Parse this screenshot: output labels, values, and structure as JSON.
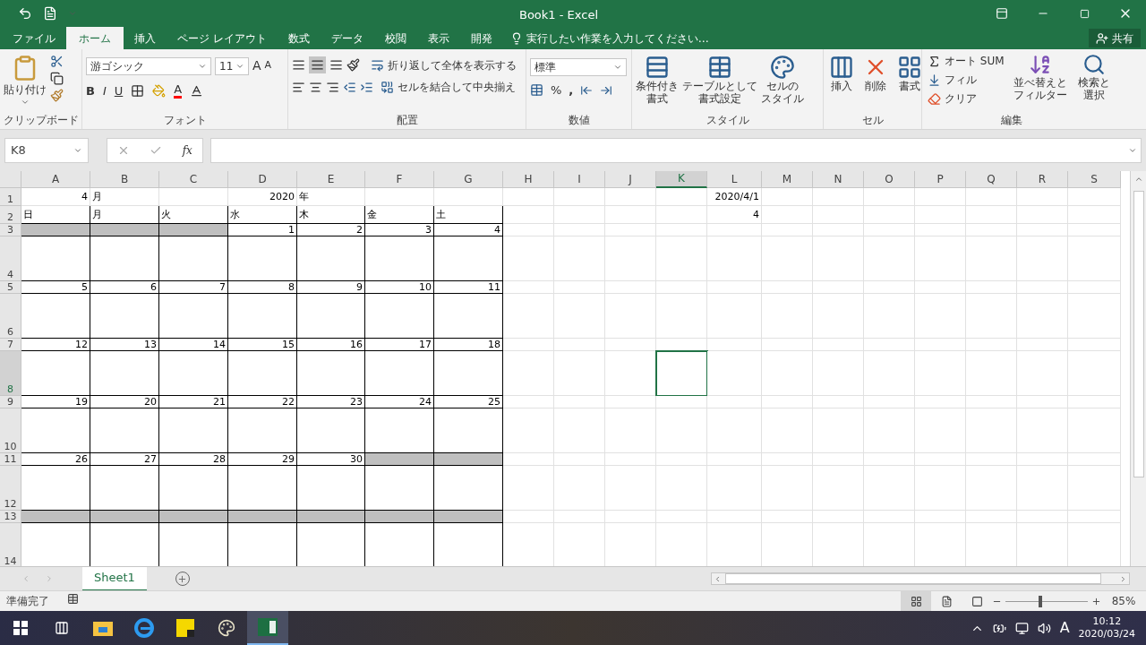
{
  "title_bar": {
    "title": "Book1 - Excel"
  },
  "tabs": [
    {
      "label": "ファイル",
      "selected": false
    },
    {
      "label": "ホーム",
      "selected": true
    },
    {
      "label": "挿入",
      "selected": false
    },
    {
      "label": "ページ レイアウト",
      "selected": false
    },
    {
      "label": "数式",
      "selected": false
    },
    {
      "label": "データ",
      "selected": false
    },
    {
      "label": "校閲",
      "selected": false
    },
    {
      "label": "表示",
      "selected": false
    },
    {
      "label": "開発",
      "selected": false
    }
  ],
  "tell_me": {
    "placeholder": "実行したい作業を入力してください…"
  },
  "share": "共有",
  "ribbon": {
    "clipboard": {
      "label": "クリップボード",
      "paste": "貼り付け"
    },
    "font": {
      "label": "フォント",
      "font_name": "游ゴシック",
      "font_size": "11",
      "grow": "A",
      "shrink": "A",
      "bold": "B",
      "italic": "I",
      "underline": "U",
      "font_color": "A"
    },
    "alignment": {
      "label": "配置",
      "wrap": "折り返して全体を表示する",
      "merge": "セルを結合して中央揃え"
    },
    "number": {
      "label": "数値",
      "format": "標準",
      "percent": "%",
      "comma": ","
    },
    "styles": {
      "label": "スタイル",
      "buttons": [
        [
          "条件付き",
          "書式"
        ],
        [
          "テーブルとして",
          "書式設定"
        ],
        [
          "セルの",
          "スタイル"
        ]
      ]
    },
    "cells": {
      "label": "セル",
      "buttons": [
        "挿入",
        "削除",
        "書式"
      ]
    },
    "editing": {
      "label": "編集",
      "autosum": "オート SUM",
      "fill": "フィル",
      "clear": "クリア",
      "sort": [
        "並べ替えと",
        "フィルター"
      ],
      "find": [
        "検索と",
        "選択"
      ]
    }
  },
  "formula_bar": {
    "name_box": "K8",
    "fx": "fx"
  },
  "grid": {
    "columns": [
      {
        "label": "A",
        "selected": false
      },
      {
        "label": "B",
        "selected": false
      },
      {
        "label": "C",
        "selected": false
      },
      {
        "label": "D",
        "selected": false
      },
      {
        "label": "E",
        "selected": false
      },
      {
        "label": "F",
        "selected": false
      },
      {
        "label": "G",
        "selected": false
      },
      {
        "label": "H",
        "selected": false
      },
      {
        "label": "I",
        "selected": false
      },
      {
        "label": "J",
        "selected": false
      },
      {
        "label": "K",
        "selected": true
      },
      {
        "label": "L",
        "selected": false
      },
      {
        "label": "M",
        "selected": false
      },
      {
        "label": "N",
        "selected": false
      },
      {
        "label": "O",
        "selected": false
      },
      {
        "label": "P",
        "selected": false
      },
      {
        "label": "Q",
        "selected": false
      },
      {
        "label": "R",
        "selected": false
      },
      {
        "label": "S",
        "selected": false
      }
    ],
    "rows": [
      {
        "label": "1",
        "selected": false,
        "kind": "title",
        "cells": [
          {
            "text": "4",
            "kind": "number"
          },
          {
            "text": "月",
            "kind": "text"
          },
          null,
          {
            "text": "2020",
            "kind": "number"
          },
          {
            "text": "年",
            "kind": "text"
          },
          null,
          null
        ],
        "column_l": "2020/4/1"
      },
      {
        "label": "2",
        "selected": false,
        "kind": "weekday",
        "cells": [
          {
            "text": "日",
            "kind": "text"
          },
          {
            "text": "月",
            "kind": "text"
          },
          {
            "text": "火",
            "kind": "text"
          },
          {
            "text": "水",
            "kind": "text"
          },
          {
            "text": "木",
            "kind": "text"
          },
          {
            "text": "金",
            "kind": "text"
          },
          {
            "text": "土",
            "kind": "text"
          }
        ],
        "column_l": "4"
      },
      {
        "label": "3",
        "selected": false,
        "kind": "dates",
        "cells": [
          {
            "shaded": true
          },
          {
            "shaded": true
          },
          {
            "shaded": true
          },
          {
            "text": "1",
            "shaded": false
          },
          {
            "text": "2",
            "shaded": false
          },
          {
            "text": "3",
            "shaded": false
          },
          {
            "text": "4",
            "shaded": false
          }
        ]
      },
      {
        "label": "4",
        "selected": false,
        "kind": "notes"
      },
      {
        "label": "5",
        "selected": false,
        "kind": "dates",
        "cells": [
          {
            "text": "5",
            "shaded": false
          },
          {
            "text": "6",
            "shaded": false
          },
          {
            "text": "7",
            "shaded": false
          },
          {
            "text": "8",
            "shaded": false
          },
          {
            "text": "9",
            "shaded": false
          },
          {
            "text": "10",
            "shaded": false
          },
          {
            "text": "11",
            "shaded": false
          }
        ]
      },
      {
        "label": "6",
        "selected": false,
        "kind": "notes"
      },
      {
        "label": "7",
        "selected": false,
        "kind": "dates",
        "cells": [
          {
            "text": "12",
            "shaded": false
          },
          {
            "text": "13",
            "shaded": false
          },
          {
            "text": "14",
            "shaded": false
          },
          {
            "text": "15",
            "shaded": false
          },
          {
            "text": "16",
            "shaded": false
          },
          {
            "text": "17",
            "shaded": false
          },
          {
            "text": "18",
            "shaded": false
          }
        ]
      },
      {
        "label": "8",
        "selected": true,
        "kind": "notes"
      },
      {
        "label": "9",
        "selected": false,
        "kind": "dates",
        "cells": [
          {
            "text": "19",
            "shaded": false
          },
          {
            "text": "20",
            "shaded": false
          },
          {
            "text": "21",
            "shaded": false
          },
          {
            "text": "22",
            "shaded": false
          },
          {
            "text": "23",
            "shaded": false
          },
          {
            "text": "24",
            "shaded": false
          },
          {
            "text": "25",
            "shaded": false
          }
        ]
      },
      {
        "label": "10",
        "selected": false,
        "kind": "notes"
      },
      {
        "label": "11",
        "selected": false,
        "kind": "dates",
        "cells": [
          {
            "text": "26",
            "shaded": false
          },
          {
            "text": "27",
            "shaded": false
          },
          {
            "text": "28",
            "shaded": false
          },
          {
            "text": "29",
            "shaded": false
          },
          {
            "text": "30",
            "shaded": false
          },
          {
            "shaded": true
          },
          {
            "shaded": true
          }
        ]
      },
      {
        "label": "12",
        "selected": false,
        "kind": "notes"
      },
      {
        "label": "13",
        "selected": false,
        "kind": "dates",
        "cells": [
          {
            "shaded": true
          },
          {
            "shaded": true
          },
          {
            "shaded": true
          },
          {
            "shaded": true
          },
          {
            "shaded": true
          },
          {
            "shaded": true
          },
          {
            "shaded": true
          }
        ]
      },
      {
        "label": "14",
        "selected": false,
        "kind": "notes"
      }
    ]
  },
  "sheet_tabs": [
    {
      "label": "Sheet1",
      "selected": true
    }
  ],
  "status_bar": {
    "status": "準備完了",
    "zoom": "85%",
    "zoom_slider": {
      "level": 0.42
    }
  },
  "taskbar": {
    "ime": "A",
    "time": "10:12",
    "date": "2020/03/24"
  }
}
